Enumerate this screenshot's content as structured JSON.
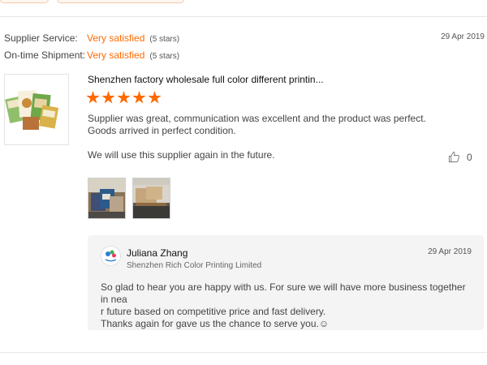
{
  "ratings": [
    {
      "label": "Supplier Service:",
      "value": "Very satisfied",
      "stars": "(5 stars)"
    },
    {
      "label": "On-time Shipment:",
      "value": "Very satisfied",
      "stars": "(5 stars)"
    }
  ],
  "review": {
    "date": "29 Apr 2019",
    "product_title": "Shenzhen factory wholesale full color different printin...",
    "star_rating": 5,
    "text_line1": "Supplier was great, communication was excellent and the product was perfect.",
    "text_line2": "Goods arrived in perfect condition.",
    "text_line3": "We will use this supplier again in the future.",
    "helpful_count": "0"
  },
  "reply": {
    "name": "Juliana Zhang",
    "company": "Shenzhen Rich Color Printing Limited",
    "date": "29 Apr 2019",
    "line1": "So glad to hear you are happy with us. For sure we will have more  business together in nea",
    "line2": "r future based on competitive price and fast delivery.",
    "line3": "Thanks again for gave us the chance to serve you.☺"
  },
  "colors": {
    "accent": "#ff6a00",
    "divider": "#e6e6e6",
    "reply_bg": "#f4f4f4"
  },
  "icons": {
    "helpful": "thumbs-up-icon"
  }
}
